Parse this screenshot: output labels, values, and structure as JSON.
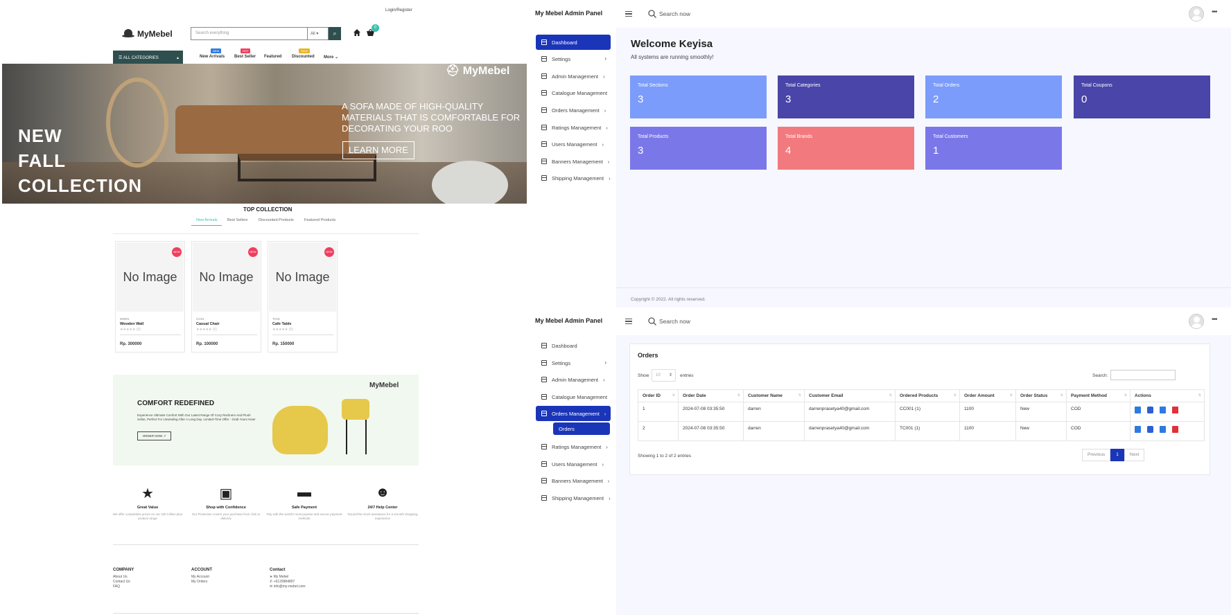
{
  "store": {
    "login": "Login/Register",
    "logo": "MyMebel",
    "search_placeholder": "Search everything",
    "search_category": "All",
    "cart_count": "0",
    "all_categories": "ALL CATEGORIES",
    "nav": [
      {
        "label": "New Arrivals",
        "badge": "NEW",
        "badge_color": "#2d7be0"
      },
      {
        "label": "Best Seller",
        "badge": "HOT",
        "badge_color": "#ef3f5f"
      },
      {
        "label": "Featured",
        "badge": "",
        "badge_color": ""
      },
      {
        "label": "Discounted",
        "badge": "SALE",
        "badge_color": "#e6b422"
      },
      {
        "label": "More",
        "badge": "",
        "badge_color": ""
      }
    ],
    "hero": {
      "title_lines": [
        "NEW",
        "FALL",
        "COLLECTION"
      ],
      "subtitle": "A SOFA MADE OF HIGH-QUALITY MATERIALS THAT IS COMFORTABLE FOR DECORATING YOUR ROO",
      "button": "LEARN MORE",
      "logo": "MyMebel"
    },
    "top_collection": "TOP COLLECTION",
    "tabs": [
      "New Arrivals",
      "Best Sellers",
      "Discounted Products",
      "Featured Products"
    ],
    "products": [
      {
        "image": "No Image",
        "badge": "NEW",
        "code": "WW01",
        "name": "Wooden Wall",
        "stars": "★★★★★",
        "reviews": "(0)",
        "price": "Rp. 300000"
      },
      {
        "image": "No Image",
        "badge": "NEW",
        "code": "CC01",
        "name": "Casual Chair",
        "stars": "★★★★★",
        "reviews": "(0)",
        "price": "Rp. 100000"
      },
      {
        "image": "No Image",
        "badge": "NEW",
        "code": "TC01",
        "name": "Cafe Table",
        "stars": "★★★★★",
        "reviews": "(0)",
        "price": "Rp. 150000"
      }
    ],
    "banner": {
      "title": "COMFORT REDEFINED",
      "desc": "Experience Ultimate Comfort With Our Latest Range Of Cozy Recliners And Plush Sofas, Perfect For Unwinding After A Long Day. Limited-Time Offer - Grab Yours Now!",
      "button": "ORDER NOW",
      "logo": "MyMebel"
    },
    "features": [
      {
        "icon": "star-icon",
        "glyph": "★",
        "title": "Great Value",
        "desc": "We offer competitive prices on our 100 million plus product range"
      },
      {
        "icon": "money-icon",
        "glyph": "▣",
        "title": "Shop with Confidence",
        "desc": "Our Protection covers your purchase from click to delivery"
      },
      {
        "icon": "card-icon",
        "glyph": "▬",
        "title": "Safe Payment",
        "desc": "Pay with the world's most popular and secure payment methods"
      },
      {
        "icon": "support-icon",
        "glyph": "☻",
        "title": "24/7 Help Center",
        "desc": "Round-the-clock assistance for a smooth shopping experience"
      }
    ],
    "footer": {
      "company": {
        "title": "COMPANY",
        "links": [
          "About Us",
          "Contact Us",
          "FAQ"
        ]
      },
      "account": {
        "title": "ACCOUNT",
        "links": [
          "My Account",
          "My Orders"
        ]
      },
      "contact": {
        "title": "Contact",
        "lines": [
          "My Mebel",
          "+6129984897",
          "info@my-mebel.com"
        ]
      }
    }
  },
  "admin": {
    "brand": "My Mebel Admin Panel",
    "search_placeholder": "Search now",
    "sidebar": [
      "Dashboard",
      "Settings",
      "Admin Management",
      "Catalogue Management",
      "Orders Management",
      "Ratings Management",
      "Users Management",
      "Banners Management",
      "Shipping Management"
    ],
    "sub_orders": "Orders",
    "welcome": "Welcome Keyisa",
    "welcome_sub": "All systems are running smoothly!",
    "tiles": [
      {
        "label": "Total Sections",
        "value": "3",
        "color": "#7b9cfb"
      },
      {
        "label": "Total Categories",
        "value": "3",
        "color": "#4a45a8"
      },
      {
        "label": "Total Orders",
        "value": "2",
        "color": "#7b9cfb"
      },
      {
        "label": "Total Coupons",
        "value": "0",
        "color": "#4a45a8"
      },
      {
        "label": "Total Products",
        "value": "3",
        "color": "#7a78e8"
      },
      {
        "label": "Total Brands",
        "value": "4",
        "color": "#f27a7e"
      },
      {
        "label": "Total Customers",
        "value": "1",
        "color": "#7a78e8"
      }
    ],
    "copyright": "Copyright © 2022. All rights reserved.",
    "orders": {
      "title": "Orders",
      "show": "Show",
      "length": "10",
      "entries": "entries",
      "search_label": "Search:",
      "columns": [
        "Order ID",
        "Order Date",
        "Customer Name",
        "Customer Email",
        "Ordered Products",
        "Order Amount",
        "Order Status",
        "Payment Method",
        "Actions"
      ],
      "rows": [
        [
          "1",
          "2024-07-08 03:35:50",
          "darren",
          "darrenprasetya40@gmail.com",
          "CC001 (1)",
          "1100",
          "New",
          "COD"
        ],
        [
          "2",
          "2024-07-08 03:35:50",
          "darren",
          "darrenprasetya40@gmail.com",
          "TC001 (1)",
          "1100",
          "New",
          "COD"
        ]
      ],
      "showing": "Showing 1 to 2 of 2 entries",
      "prev": "Previous",
      "page": "1",
      "next": "Next"
    }
  }
}
